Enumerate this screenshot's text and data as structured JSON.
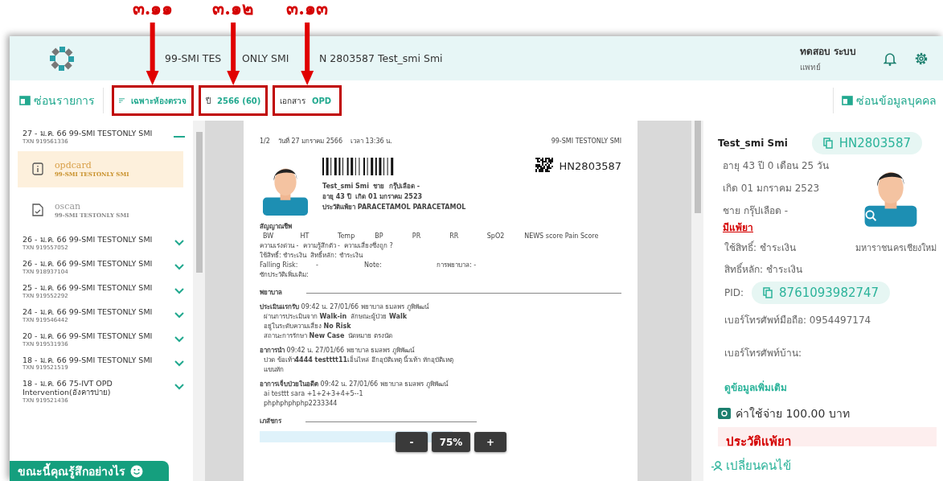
{
  "header": {
    "site_parts": [
      "99-SMI TES",
      "ONLY SMI"
    ],
    "patient": "N 2803587 Test_smi Smi",
    "user_name": "ทดสอบ ระบบ",
    "user_role": "แพทย์"
  },
  "toolbar": {
    "hide_list": "ซ่อนรายการ",
    "filter": {
      "label": "เฉพาะห้องตรวจ",
      "annotation": "๓.๑๑"
    },
    "year": {
      "label": "ปี",
      "value": "2566 (60)",
      "annotation": "๓.๑๒"
    },
    "doc": {
      "label": "เอกสาร",
      "value": "OPD",
      "annotation": "๓.๑๓"
    },
    "hide_person": "ซ่อนข้อมูลบุคคล"
  },
  "visits": [
    {
      "title": "27 - ม.ค. 66 99-SMI TESTONLY SMI",
      "txn": "TXN 919561336",
      "expanded": true,
      "documents": [
        {
          "kind": "info",
          "name": "opdcard",
          "site": "99-SMI TESTONLY SMI",
          "selected": true
        },
        {
          "kind": "scan",
          "name": "oscan",
          "site": "99-SMI TESTONLY SMI",
          "selected": false
        }
      ]
    },
    {
      "title": "26 - ม.ค. 66 99-SMI TESTONLY SMI",
      "txn": "TXN 919557052",
      "expanded": false
    },
    {
      "title": "26 - ม.ค. 66 99-SMI TESTONLY SMI",
      "txn": "TXN 918937104",
      "expanded": false
    },
    {
      "title": "25 - ม.ค. 66 99-SMI TESTONLY SMI",
      "txn": "TXN 919552292",
      "expanded": false
    },
    {
      "title": "24 - ม.ค. 66 99-SMI TESTONLY SMI",
      "txn": "TXN 919546442",
      "expanded": false
    },
    {
      "title": "20 - ม.ค. 66 99-SMI TESTONLY SMI",
      "txn": "TXN 919531936",
      "expanded": false
    },
    {
      "title": "18 - ม.ค. 66 99-SMI TESTONLY SMI",
      "txn": "TXN 919521519",
      "expanded": false
    },
    {
      "title": "18 - ม.ค. 66 75-IVT OPD Intervention(อังคารบ่าย)",
      "txn": "TXN 919521436",
      "expanded": false
    }
  ],
  "feedback": "ขณะนี้คุณรู้สึกอย่างไร",
  "document": {
    "page": "1/2",
    "date": "วันที่ 27 มกราคม 2566",
    "time": "เวลา 13:36 น.",
    "site": "99-SMI TESTONLY SMI",
    "hn": "HN2803587",
    "patient_lines": [
      "Test_smi Smi  ชาย  กรุ๊ปเลือด -",
      "อายุ 43 ปี  เกิด 01 มกราคม 2523",
      "ประวัติแพ้ยา PARACETAMOL PARACETAMOL"
    ],
    "vitals_title": "สัญญาณชีพ",
    "vitals": [
      "BW",
      "HT",
      "Temp",
      "BP",
      "PR",
      "RR",
      "SpO2",
      "NEWS score Pain Score"
    ],
    "info_lines": [
      "ความเร่งด่วน -  ความรู้สึกตัว -  ความเสี่ยงซึ่งถูก ?",
      "ใช้สิทธิ์: ชำระเงิน  สิทธิ์หลัก: ชำระเงิน"
    ],
    "falling": [
      "Falling Risk:",
      "-",
      "Note:",
      "การพยาบาล: -"
    ],
    "history": "ซักประวัติเพิ่มเติม:",
    "sections": [
      {
        "title": "พยาบาล",
        "entries": [
          {
            "heading": "**ประเมินแรกรับ**  09:42 น. 27/01/66 พยาบาล ธมลพร ภูพิพัฒน์",
            "lines": [
              "ผ่านการประเมินจาก **Walk-in**  ลักษณะผู้ป่วย **Walk**",
              "อยู่ในระดับความเสี่ยง **No Risk**",
              "สถานะการรักษา **New Case**  นัดหมาย ตรงนัด"
            ]
          },
          {
            "heading": "**อาการนำ**  09:42 น. 27/01/66 พยาบาล ธมลพร ภูพิพัฒน์",
            "lines": [
              "ปวด ข้อเท้า**4444 testttt11**เอ็นไหล่ อึกอุบัติเหตุ นิ้วเท้า หักอุบัติเหตุ แขนหัก"
            ]
          },
          {
            "heading": "**อาการเจ็บป่วยในอดีต**  09:42 น. 27/01/66 พยาบาล ธมลพร ภูพิพัฒน์",
            "lines": [
              "ai testtt sara +1+2+3+4+5--1",
              "phphphphphp2233344"
            ]
          }
        ]
      },
      {
        "title": "เภสัชกร"
      }
    ]
  },
  "zoom": {
    "minus": "-",
    "value": "75%",
    "plus": "+"
  },
  "patient": {
    "name": "Test_smi Smi",
    "hn": "HN2803587",
    "age": "อายุ 43 ปี 0 เดือน 25 วัน",
    "birth": "เกิด 01 มกราคม 2523",
    "sex_blood": "ชาย กรุ๊ปเลือด -",
    "allergy_link": "มีแพ้ยา",
    "right": "ใช้สิทธิ์: ชำระเงิน",
    "hospital": "มหาราชนครเชียงใหม่",
    "main_right": "สิทธิ์หลัก: ชำระเงิน",
    "pid_label": "PID:",
    "pid": "8761093982747",
    "mobile": "เบอร์โทรศัพท์มือถือ: 0954497174",
    "home_phone": "เบอร์โทรศัพท์บ้าน:",
    "more": "ดูข้อมูลเพิ่มเติม",
    "cost": "ค่าใช้จ่าย 100.00 บาท",
    "allergy_history": "ประวัติแพ้ยา",
    "change_patient": "เปลี่ยนคนไข้"
  }
}
